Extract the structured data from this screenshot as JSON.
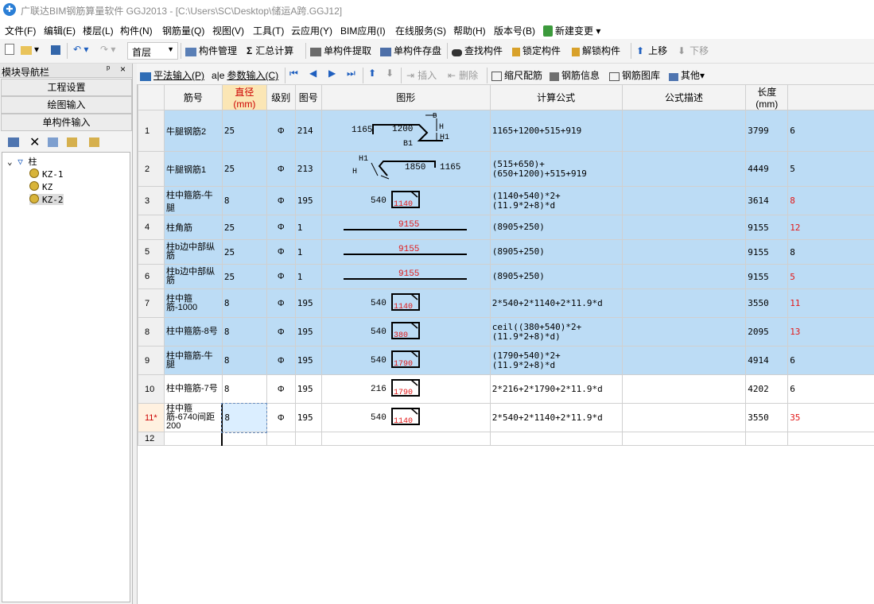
{
  "window": {
    "title": "广联达BIM钢筋算量软件 GGJ2013 - [C:\\Users\\SC\\Desktop\\储运A跨.GGJ12]"
  },
  "menu": [
    "文件(F)",
    "编辑(E)",
    "楼层(L)",
    "构件(N)",
    "钢筋量(Q)",
    "视图(V)",
    "工具(T)",
    "云应用(Y)",
    "BIM应用(I)",
    "在线服务(S)",
    "帮助(H)",
    "版本号(B)",
    "新建变更"
  ],
  "toolbar": {
    "floor": "首层",
    "buttons": [
      "构件管理",
      "汇总计算",
      "单构件提取",
      "单构件存盘",
      "查找构件",
      "锁定构件",
      "解锁构件",
      "上移",
      "下移"
    ]
  },
  "nav": {
    "title": "模块导航栏",
    "pin": "ᵖ",
    "close": "×",
    "sections": [
      "工程设置",
      "绘图输入",
      "单构件输入"
    ],
    "tree_root": "柱",
    "tree_items": [
      "KZ-1",
      "KZ",
      "KZ-2"
    ]
  },
  "subtoolbar": [
    "平法输入(P)",
    "参数输入(C)",
    "插入",
    "删除",
    "缩尺配筋",
    "钢筋信息",
    "钢筋图库",
    "其他"
  ],
  "grid": {
    "headers": [
      "",
      "筋号",
      "直径(mm)",
      "级别",
      "图号",
      "图形",
      "计算公式",
      "公式描述",
      "长度(mm)",
      ""
    ],
    "rows": [
      {
        "no": "1",
        "name": "牛腿钢筋2",
        "dia": "25",
        "grade": "Φ",
        "fig": "214",
        "formula": "1165+1200+515+919",
        "len": "3799",
        "count": "6"
      },
      {
        "no": "2",
        "name": "牛腿钢筋1",
        "dia": "25",
        "grade": "Φ",
        "fig": "213",
        "formula": "(515+650)+(650+1200)+515+919",
        "len": "4449",
        "count": "5"
      },
      {
        "no": "3",
        "name": "柱中箍筋-牛腿",
        "dia": "8",
        "grade": "Φ",
        "fig": "195",
        "formula": "(1140+540)*2+(11.9*2+8)*d",
        "len": "3614",
        "count": "8"
      },
      {
        "no": "4",
        "name": "柱角筋",
        "dia": "25",
        "grade": "Φ",
        "fig": "1",
        "formula": "(8905+250)",
        "len": "9155",
        "count": "12"
      },
      {
        "no": "5",
        "name": "柱b边中部纵筋",
        "dia": "25",
        "grade": "Φ",
        "fig": "1",
        "formula": "(8905+250)",
        "len": "9155",
        "count": "8"
      },
      {
        "no": "6",
        "name": "柱b边中部纵筋",
        "dia": "25",
        "grade": "Φ",
        "fig": "1",
        "formula": "(8905+250)",
        "len": "9155",
        "count": "5"
      },
      {
        "no": "7",
        "name": "柱中箍筋-1000",
        "dia": "8",
        "grade": "Φ",
        "fig": "195",
        "formula": "2*540+2*1140+2*11.9*d",
        "len": "3550",
        "count": "11"
      },
      {
        "no": "8",
        "name": "柱中箍筋-8号",
        "dia": "8",
        "grade": "Φ",
        "fig": "195",
        "formula": "ceil((380+540)*2+(11.9*2+8)*d)",
        "len": "2095",
        "count": "13"
      },
      {
        "no": "9",
        "name": "柱中箍筋-牛腿",
        "dia": "8",
        "grade": "Φ",
        "fig": "195",
        "formula": "(1790+540)*2+(11.9*2+8)*d",
        "len": "4914",
        "count": "6"
      },
      {
        "no": "10",
        "name": "柱中箍筋-7号",
        "dia": "8",
        "grade": "Φ",
        "fig": "195",
        "formula": "2*216+2*1790+2*11.9*d",
        "len": "4202",
        "count": "6"
      },
      {
        "no": "11*",
        "name": "柱中箍筋-6740间距200",
        "dia": "8",
        "grade": "Φ",
        "fig": "195",
        "formula": "2*540+2*1140+2*11.9*d",
        "len": "3550",
        "count": "35"
      },
      {
        "no": "12",
        "name": "",
        "dia": "",
        "grade": "",
        "fig": "",
        "formula": "",
        "len": "",
        "count": ""
      }
    ],
    "shape_labels": {
      "r1": [
        "1165",
        "1200",
        "B1",
        "B",
        "H",
        "H1"
      ],
      "r2": [
        "H1",
        "H",
        "1850",
        "1165"
      ],
      "r3": [
        "540",
        "1140"
      ],
      "r4": [
        "9155"
      ],
      "r5": [
        "9155"
      ],
      "r6": [
        "9155"
      ],
      "r7": [
        "540",
        "1140"
      ],
      "r8": [
        "540",
        "380"
      ],
      "r9": [
        "540",
        "1790"
      ],
      "r10": [
        "216",
        "1790"
      ],
      "r11": [
        "540",
        "1140"
      ]
    }
  },
  "colors": {
    "selected_row": "#bcdcf5",
    "accent_red": "#e21818",
    "title_gray": "#8a8a8a"
  }
}
